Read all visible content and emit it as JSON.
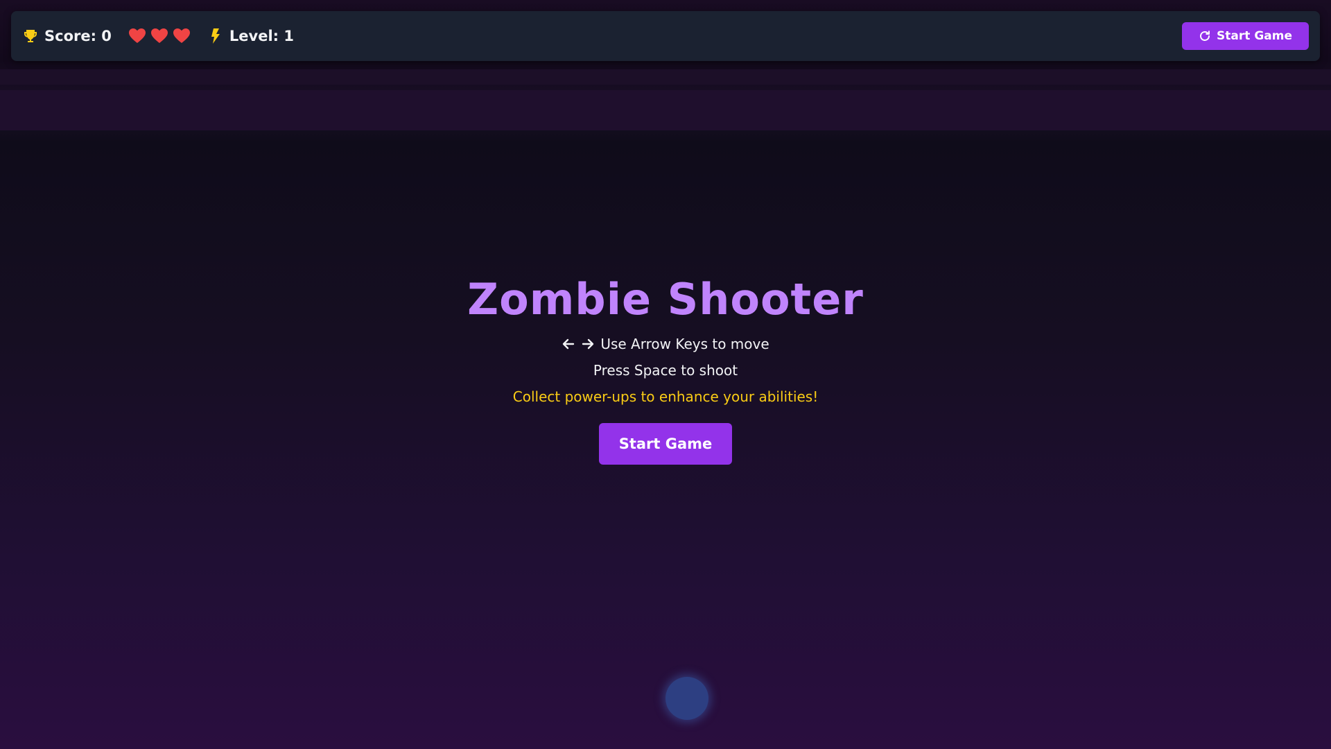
{
  "hud": {
    "score_label": "Score: 0",
    "level_label": "Level: 1",
    "lives": 3,
    "restart_button_label": "Start Game",
    "icons": {
      "score": "trophy-icon",
      "lives": "heart-icon",
      "level": "lightning-bolt-icon",
      "restart": "rotate-cw-icon"
    }
  },
  "overlay": {
    "title": "Zombie Shooter",
    "move_instruction": "Use Arrow Keys to move",
    "shoot_instruction": "Press Space to shoot",
    "powerup_hint": "Collect power-ups to enhance your abilities!",
    "start_button_label": "Start Game"
  },
  "colors": {
    "accent": "#9333ea",
    "title": "#c084fc",
    "hint": "#facc15",
    "heart": "#ef4444",
    "trophy": "#facc15",
    "player": "#2d3f82"
  }
}
